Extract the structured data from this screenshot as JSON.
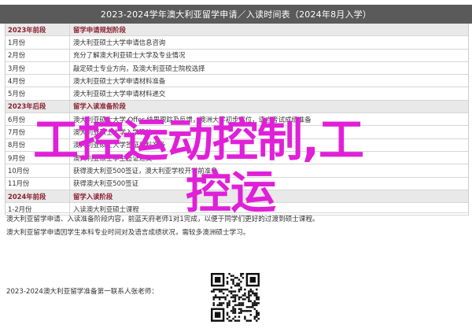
{
  "title": "2023-2024学年澳大利亚留学申请／入读时间表（2024年8月入学）",
  "rows": [
    {
      "period": "2023年前段",
      "item": "留学申请规划阶段",
      "section": true
    },
    {
      "period": "1月份",
      "item": "澳大利亚硕士大学申请信息咨询"
    },
    {
      "period": "2月份",
      "item": "充分了解澳大利亚硕士大学及专业情况"
    },
    {
      "period": "3月份",
      "item": "敲定硕士专业方向，及澳大利亚硕士院校选择"
    },
    {
      "period": "4月份",
      "item": "澳大利亚硕士大学申请材料准备"
    },
    {
      "period": "5月份",
      "item": "澳大利亚硕士大学申请材料递交"
    },
    {
      "period": "2023年后段",
      "item": "留学入读准备阶段",
      "section": true
    },
    {
      "period": "6月份",
      "item": "澳大利亚硕士大学 Offer 结果跟踪及反馈，澳洲大学初步定位，语言考试成绩准备"
    },
    {
      "period": "7月份",
      "item": "澳大利亚硕士大学入学确认"
    },
    {
      "period": "8月份",
      "item": "澳大利亚硕士大学签证材料准备"
    },
    {
      "period": "9月份",
      "item": "澳大利亚硕士学生签证递交"
    },
    {
      "period": "10月份",
      "item": "获得澳大利亚500签证，澳大利亚学校开学前准备"
    },
    {
      "period": "11月份",
      "item": "获得澳大利亚500签证"
    },
    {
      "period": "2024年前段",
      "item": "留学入读阶段",
      "section": true
    },
    {
      "period": "1-2月份",
      "item": "入读澳大利亚硕士课程"
    }
  ],
  "info_lines": [
    "澳大利亚留学申请、入读准备阶段内容，前蓝天府老师1对1完成，以便于同学们更好的过渡到硕士课程。",
    "澳大利亚留学申请因学生本科专业时间对及语言成绩状况，需较多澳洲硕士学习。"
  ],
  "footer": "2023-2024澳大利亚留学准备第一联系人张老师：",
  "overlay_line1": "工控运动控制,工",
  "overlay_line2": "控运",
  "colors": {
    "title_bg": "#5a5a5a",
    "section_text": "#8a2030",
    "overlay": "#e020d8"
  },
  "icons": {
    "qr": "qr-code-icon"
  }
}
